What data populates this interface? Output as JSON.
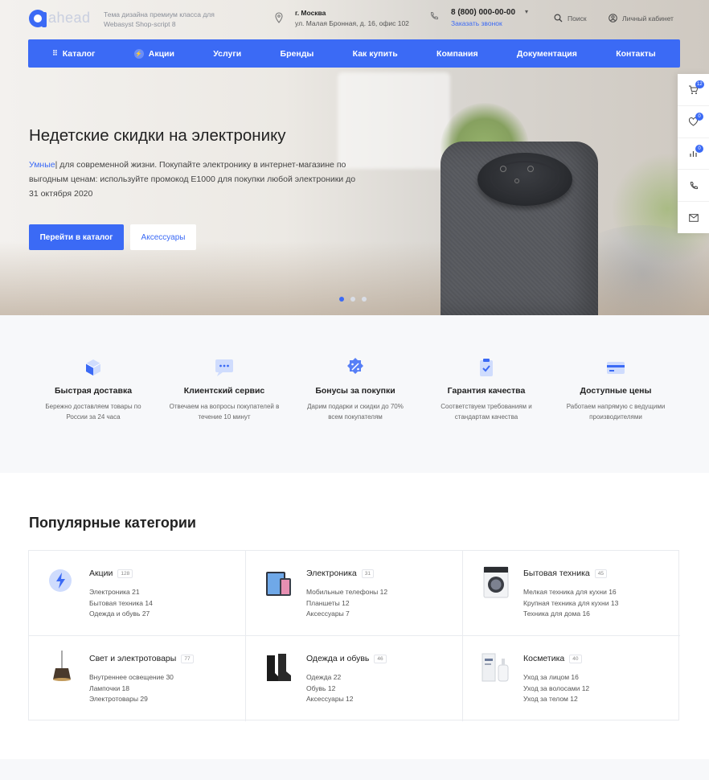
{
  "header": {
    "logo_text": "ahead",
    "tagline": "Тема дизайна премиум класса для Webasyst Shop-script 8",
    "city": "г. Москва",
    "address": "ул. Малая Бронная, д. 16, офис 102",
    "phone": "8 (800) 000-00-00",
    "callback": "Заказать звонок",
    "search": "Поиск",
    "account": "Личный кабинет"
  },
  "nav": {
    "items": [
      {
        "label": "Каталог"
      },
      {
        "label": "Акции"
      },
      {
        "label": "Услуги"
      },
      {
        "label": "Бренды"
      },
      {
        "label": "Как купить"
      },
      {
        "label": "Компания"
      },
      {
        "label": "Документация"
      },
      {
        "label": "Контакты"
      }
    ]
  },
  "hero": {
    "title": "Недетские скидки на электронику",
    "highlight": "Умные",
    "description": "| для современной жизни. Покупайте электронику в интернет-магазине по выгодным ценам: используйте промокод E1000 для покупки любой электроники до 31 октября 2020",
    "primary_button": "Перейти в каталог",
    "secondary_button": "Аксессуары",
    "slides": 3,
    "active_slide": 1
  },
  "side_panel": {
    "cart_count": "12",
    "favorites_count": "0",
    "compare_count": "0"
  },
  "features": [
    {
      "title": "Быстрая доставка",
      "text": "Бережно доставляем товары по России за 24 часа",
      "icon": "box-icon"
    },
    {
      "title": "Клиентский сервис",
      "text": "Отвечаем на вопросы покупателей в течение 10 минут",
      "icon": "chat-icon"
    },
    {
      "title": "Бонусы за покупки",
      "text": "Дарим подарки и скидки до 70% всем покупателям",
      "icon": "percent-badge-icon"
    },
    {
      "title": "Гарантия качества",
      "text": "Соответствуем требованиям и стандартам качества",
      "icon": "clipboard-check-icon"
    },
    {
      "title": "Доступные цены",
      "text": "Работаем напрямую с ведущими производителями",
      "icon": "credit-card-icon"
    }
  ],
  "categories_heading": "Популярные категории",
  "categories": [
    {
      "name": "Акции",
      "count": "128",
      "icon": "lightning-icon",
      "sub": [
        "Электроника 21",
        "Бытовая техника 14",
        "Одежда и обувь 27"
      ]
    },
    {
      "name": "Электроника",
      "count": "31",
      "icon": "tablet-icon",
      "sub": [
        "Мобильные телефоны 12",
        "Планшеты 12",
        "Аксессуары 7"
      ]
    },
    {
      "name": "Бытовая техника",
      "count": "45",
      "icon": "washing-machine-icon",
      "sub": [
        "Мелкая техника для кухни 16",
        "Крупная техника для кухни 13",
        "Техника для дома 16"
      ]
    },
    {
      "name": "Свет и электротовары",
      "count": "77",
      "icon": "lamp-icon",
      "sub": [
        "Внутреннее освещение 30",
        "Лампочки 18",
        "Электротовары 29"
      ]
    },
    {
      "name": "Одежда и обувь",
      "count": "46",
      "icon": "boots-icon",
      "sub": [
        "Одежда 22",
        "Обувь 12",
        "Аксессуары 12"
      ]
    },
    {
      "name": "Косметика",
      "count": "40",
      "icon": "cosmetics-icon",
      "sub": [
        "Уход за лицом 16",
        "Уход за волосами 12",
        "Уход за телом 12"
      ]
    }
  ],
  "colors": {
    "accent": "#3b6af5",
    "feature_icon_bg": "#cfdcfd",
    "features_bg": "#f7f8fa"
  }
}
